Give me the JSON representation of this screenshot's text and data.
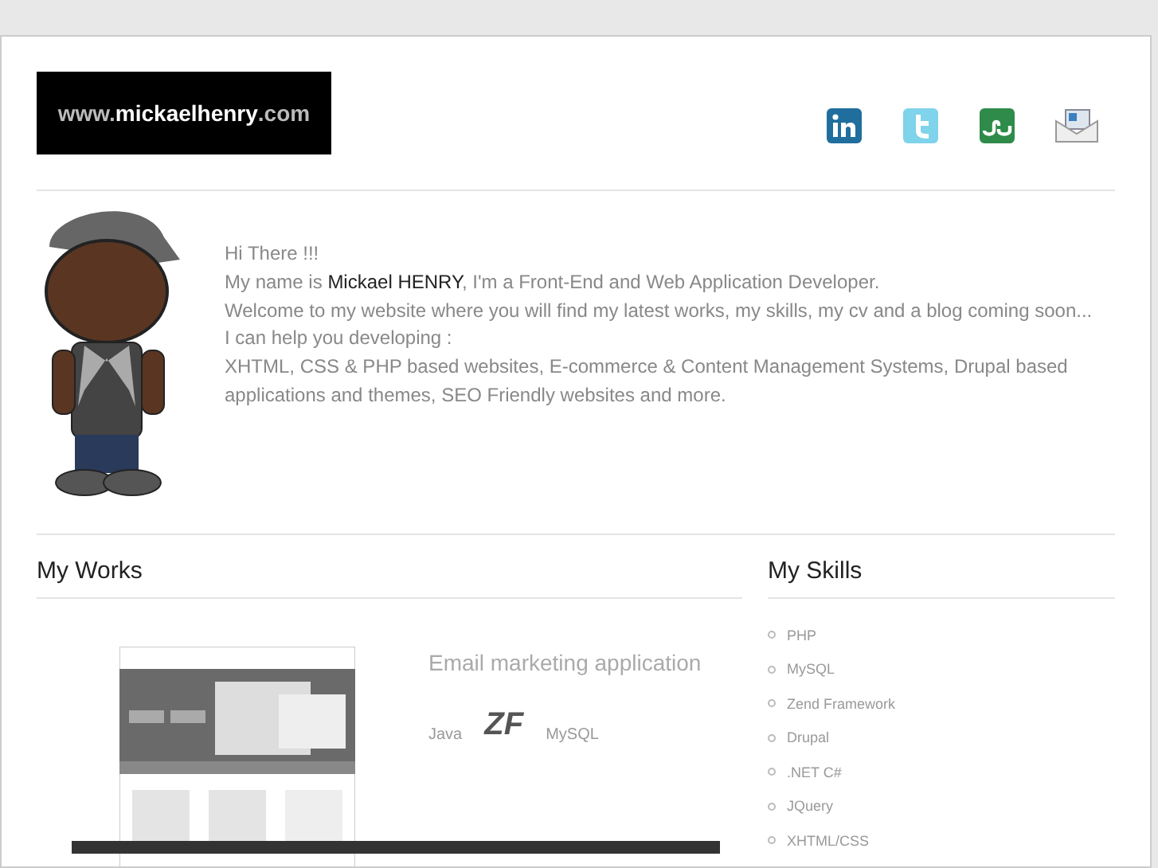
{
  "logo": {
    "prefix": "www.",
    "name": "mickaelhenry",
    "suffix": ".com"
  },
  "intro": {
    "lines": [
      "Hi There !!!",
      "My name is **Mickael HENRY**, I'm a Front-End and Web Application Developer.",
      "Welcome to my website where you will find my latest works, my skills, my cv and a blog coming soon...",
      "I can help you developing :",
      "XHTML, CSS & PHP based websites, E-commerce & Content Management Systems, Drupal based applications and themes, SEO Friendly websites and more."
    ]
  },
  "works": {
    "title": "My Works",
    "project": {
      "title": "Email marketing application",
      "technologies": [
        "Java",
        "ZF",
        "MySQL"
      ]
    }
  },
  "skills": {
    "title": "My Skills",
    "items": [
      "PHP",
      "MySQL",
      "Zend Framework",
      "Drupal",
      ".NET C#",
      "JQuery",
      "XHTML/CSS"
    ]
  }
}
